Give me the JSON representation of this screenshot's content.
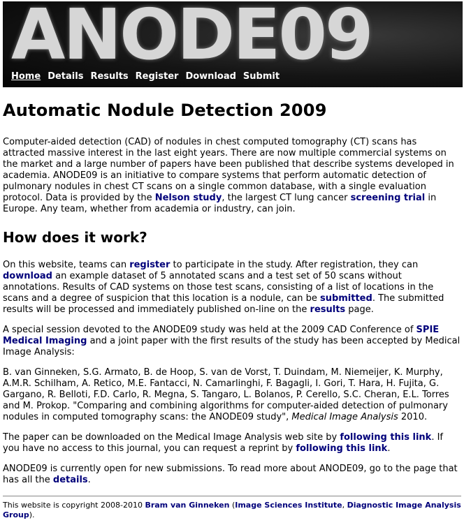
{
  "banner": {
    "title": "ANODE09",
    "nav": [
      "Home",
      "Details",
      "Results",
      "Register",
      "Download",
      "Submit"
    ]
  },
  "heading": "Automatic Nodule Detection 2009",
  "intro": {
    "t1": "Computer-aided detection (CAD) of nodules in chest computed tomography (CT) scans has attracted massive interest in the last eight years. There are now multiple commercial systems on the market and a large number of papers have been published that describe systems developed in academia. ANODE09 is an initiative to compare systems that perform automatic detection of pulmonary nodules in chest CT scans on a single common database, with a single evaluation protocol. Data is provided by the ",
    "link1": "Nelson study",
    "t2": ", the largest CT lung cancer ",
    "link2": "screening trial",
    "t3": " in Europe. Any team, whether from academia or industry, can join."
  },
  "how_heading": "How does it work?",
  "how": {
    "t1": "On this website, teams can ",
    "link1": "register",
    "t2": " to participate in the study. After registration, they can ",
    "link2": "download",
    "t3": " an example dataset of 5 annotated scans and a test set of 50 scans without annotations. Results of CAD systems on those test scans, consisting of a list of locations in the scans and a degree of suspicion that this location is a nodule, can be ",
    "link3": "submitted",
    "t4": ". The submitted results will be processed and immediately published on-line on the ",
    "link4": "results",
    "t5": " page."
  },
  "session": {
    "t1": "A special session devoted to the ANODE09 study was held at the 2009 CAD Conference of ",
    "link1": "SPIE Medical Imaging",
    "t2": " and a joint paper with the first results of the study has been accepted by Medical Image Analysis:"
  },
  "citation": {
    "text": "B. van Ginneken, S.G. Armato, B. de Hoop, S. van de Vorst, T. Duindam, M. Niemeijer, K. Murphy, A.M.R. Schilham, A. Retico, M.E. Fantacci, N. Camarlinghi, F. Bagagli, I. Gori, T. Hara, H. Fujita, G. Gargano, R. Belloti, F.D. Carlo, R. Megna, S. Tangaro, L. Bolanos, P. Cerello, S.C. Cheran, E.L. Torres and M. Prokop. \"Comparing and combining algorithms for computer-aided detection of pulmonary nodules in computed tomography scans: the ANODE09 study\", ",
    "journal": "Medical Image Analysis",
    "year": " 2010."
  },
  "download_note": {
    "t1": "The paper can be downloaded on the Medical Image Analysis web site by ",
    "link1": "following this link",
    "t2": ". If you have no access to this journal, you can request a reprint by ",
    "link2": "following this link",
    "t3": "."
  },
  "open_note": {
    "t1": "ANODE09 is currently open for new submissions. To read more about ANODE09, go to the page that has all the ",
    "link1": "details",
    "t2": "."
  },
  "footer": {
    "t1": "This website is copyright 2008-2010 ",
    "author": "Bram van Ginneken",
    "t2": " (",
    "inst1": "Image Sciences Institute",
    "t3": ", ",
    "inst2": "Diagnostic Image Analysis Group",
    "t4": ")."
  }
}
